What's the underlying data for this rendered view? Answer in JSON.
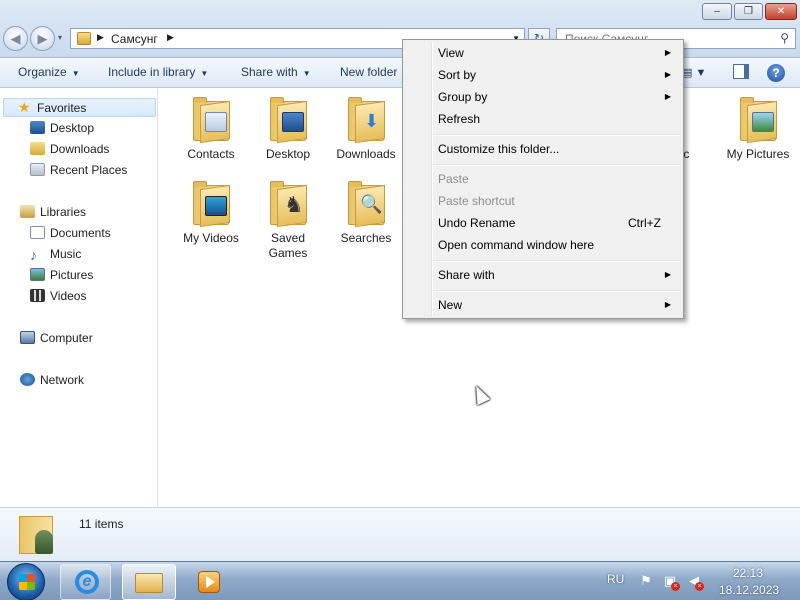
{
  "window": {
    "min_glyph": "–",
    "max_glyph": "❐",
    "close_glyph": "✕"
  },
  "nav": {
    "back_glyph": "◀",
    "forward_glyph": "▶",
    "recent_glyph": "▾"
  },
  "address": {
    "separator": "▶",
    "path": "Самсунг",
    "dropdown_glyph": "▼",
    "refresh_glyph": "↻"
  },
  "search": {
    "placeholder": "Поиск Самсунг",
    "icon_glyph": "⚲"
  },
  "toolbar": {
    "organize": "Organize",
    "include": "Include in library",
    "share": "Share with",
    "new_folder": "New folder",
    "arrow": "▼",
    "views_glyph": "▤ ▼",
    "help_glyph": "?"
  },
  "sidebar": {
    "favorites": "Favorites",
    "star_glyph": "★",
    "desktop": "Desktop",
    "downloads": "Downloads",
    "recent_places": "Recent Places",
    "libraries": "Libraries",
    "documents": "Documents",
    "music": "Music",
    "music_glyph": "♪",
    "pictures": "Pictures",
    "videos": "Videos",
    "computer": "Computer",
    "network": "Network"
  },
  "folders": [
    {
      "label": "Contacts"
    },
    {
      "label": "Desktop"
    },
    {
      "label": "Downloads"
    },
    {
      "label": "usic"
    },
    {
      "label": "My Pictures"
    },
    {
      "label": "My Videos"
    },
    {
      "label": "Saved Games"
    },
    {
      "label": "Searches"
    }
  ],
  "context_menu": {
    "view": "View",
    "sort_by": "Sort by",
    "group_by": "Group by",
    "refresh": "Refresh",
    "customize": "Customize this folder...",
    "paste": "Paste",
    "paste_shortcut": "Paste shortcut",
    "undo_rename": "Undo Rename",
    "undo_shortcut": "Ctrl+Z",
    "open_cmd": "Open command window here",
    "share_with": "Share with",
    "new": "New",
    "submenu_arrow": "▶"
  },
  "details": {
    "count": "11 items"
  },
  "taskbar": {
    "ie_glyph": "e",
    "language": "RU",
    "flag_glyph": "⚑",
    "network_glyph": "▣",
    "volume_glyph": "◀",
    "red_x": "×",
    "time": "22:13",
    "date": "18.12.2023"
  }
}
